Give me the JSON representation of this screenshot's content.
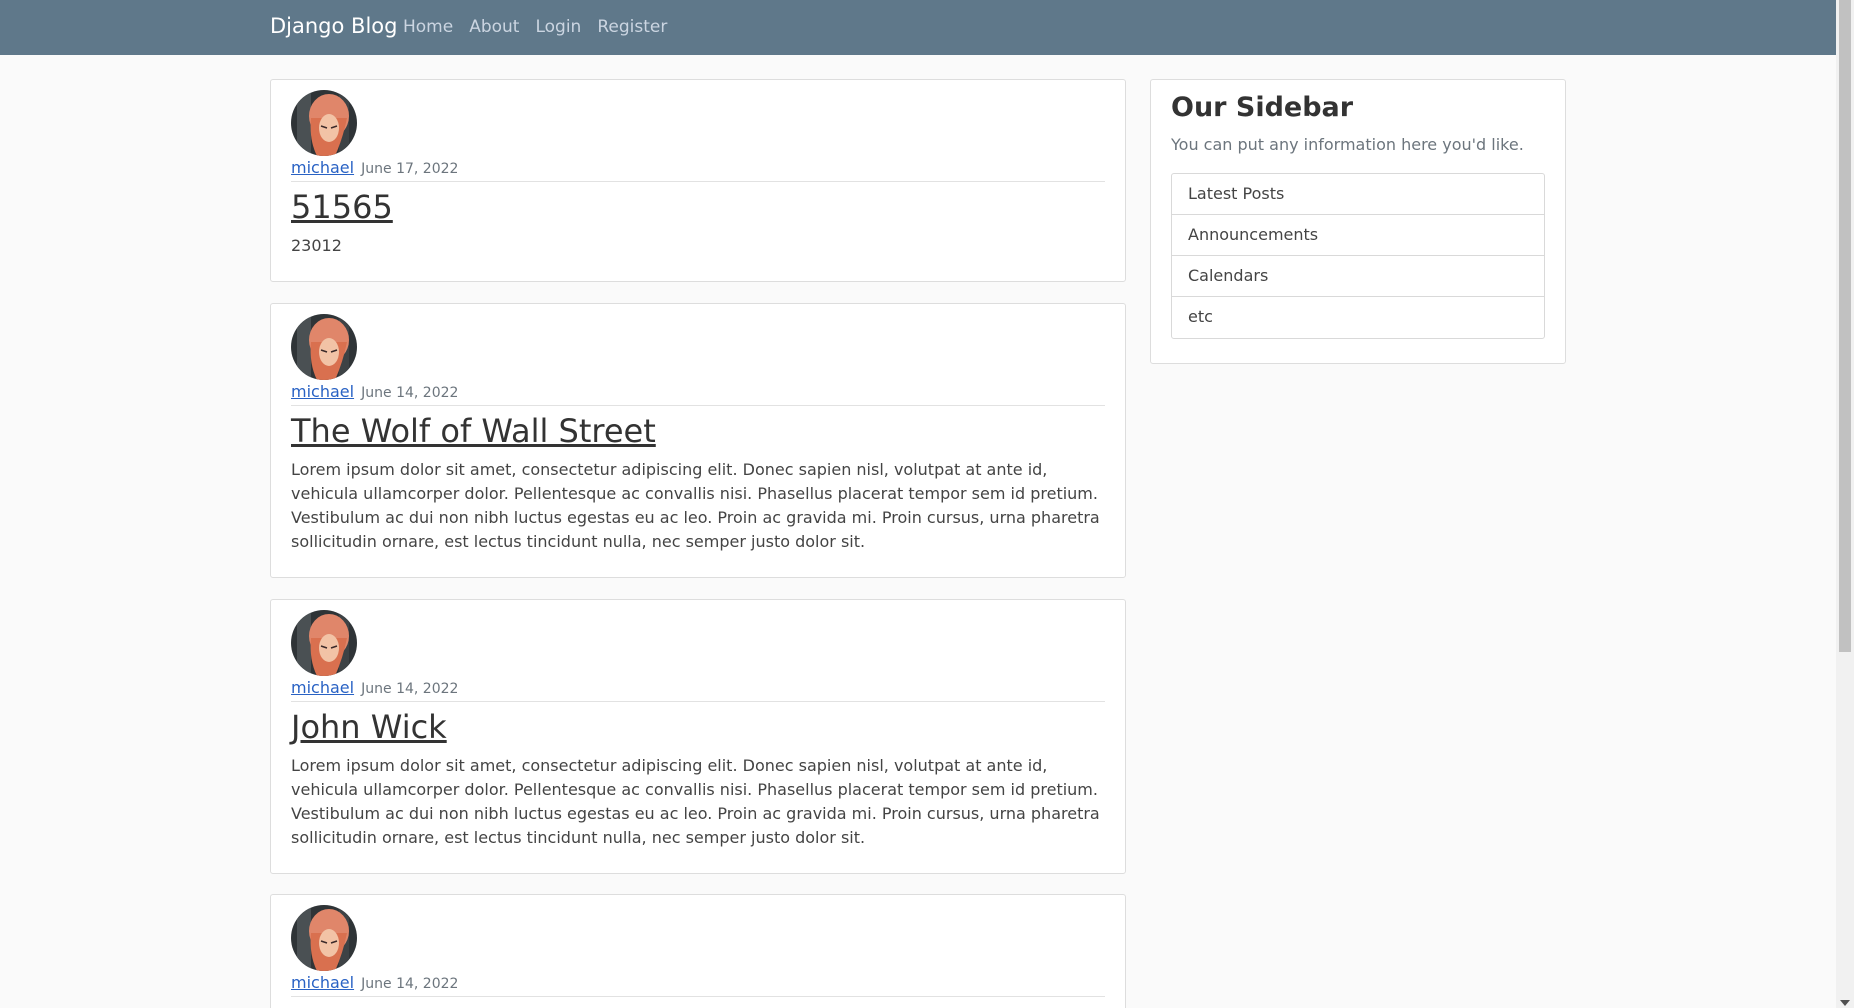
{
  "navbar": {
    "brand": "Django Blog",
    "links": [
      "Home",
      "About",
      "Login",
      "Register"
    ]
  },
  "posts": [
    {
      "author": "michael",
      "date": "June 17, 2022",
      "title": "51565",
      "content": "23012"
    },
    {
      "author": "michael",
      "date": "June 14, 2022",
      "title": "The Wolf of Wall Street",
      "content": "Lorem ipsum dolor sit amet, consectetur adipiscing elit. Donec sapien nisl, volutpat at ante id, vehicula ullamcorper dolor. Pellentesque ac convallis nisi. Phasellus placerat tempor sem id pretium. Vestibulum ac dui non nibh luctus egestas eu ac leo. Proin ac gravida mi. Proin cursus, urna pharetra sollicitudin ornare, est lectus tincidunt nulla, nec semper justo dolor sit."
    },
    {
      "author": "michael",
      "date": "June 14, 2022",
      "title": "John Wick",
      "content": "Lorem ipsum dolor sit amet, consectetur adipiscing elit. Donec sapien nisl, volutpat at ante id, vehicula ullamcorper dolor. Pellentesque ac convallis nisi. Phasellus placerat tempor sem id pretium. Vestibulum ac dui non nibh luctus egestas eu ac leo. Proin ac gravida mi. Proin cursus, urna pharetra sollicitudin ornare, est lectus tincidunt nulla, nec semper justo dolor sit."
    },
    {
      "author": "michael",
      "date": "June 14, 2022"
    }
  ],
  "sidebar": {
    "title": "Our Sidebar",
    "description": "You can put any information here you'd like.",
    "items": [
      "Latest Posts",
      "Announcements",
      "Calendars",
      "etc"
    ]
  },
  "colors": {
    "navbar": "#5f788a",
    "link": "#2962c4",
    "background": "#fafafa"
  },
  "icons": {
    "avatar": "avatar-image"
  }
}
